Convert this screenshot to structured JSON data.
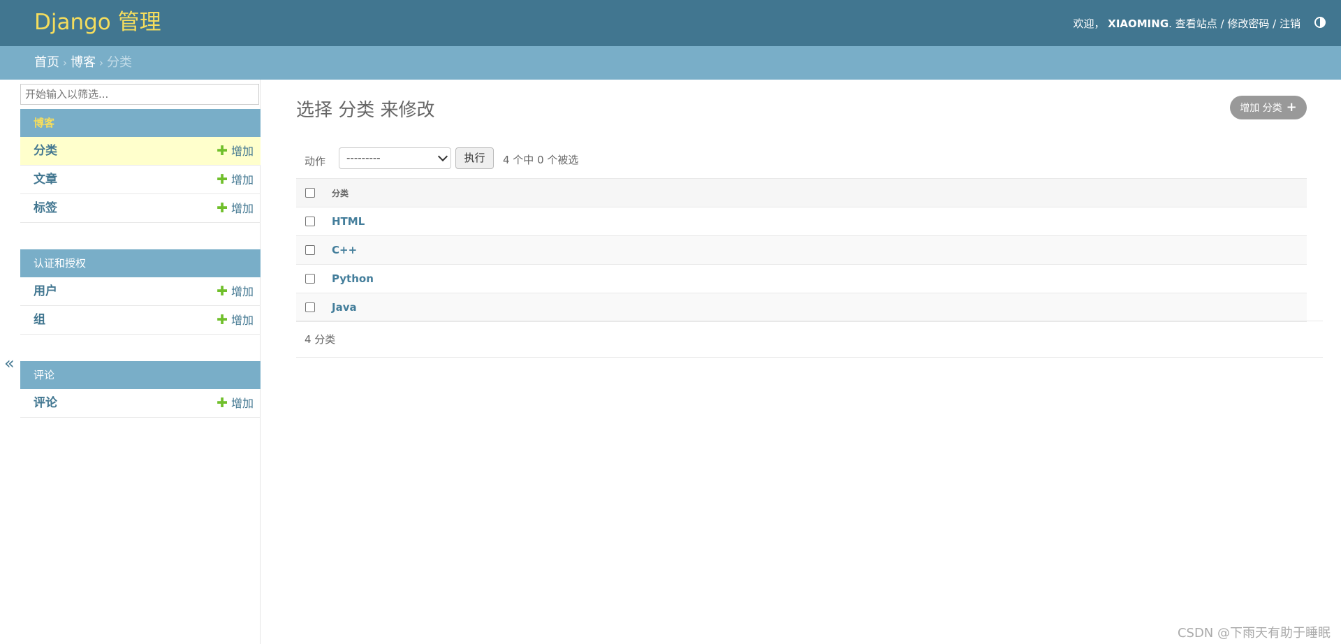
{
  "header": {
    "brand": "Django 管理",
    "welcome": "欢迎，",
    "username": "XIAOMING",
    "period": ".",
    "view_site": "查看站点",
    "slash": "/",
    "change_password": "修改密码",
    "logout": "注销"
  },
  "breadcrumbs": {
    "home": "首页",
    "app": "博客",
    "current": "分类",
    "separator": "›"
  },
  "sidebar": {
    "filter_placeholder": "开始输入以筛选...",
    "modules": [
      {
        "caption": "博客",
        "items": [
          {
            "name": "分类",
            "add": "增加"
          },
          {
            "name": "文章",
            "add": "增加"
          },
          {
            "name": "标签",
            "add": "增加"
          }
        ]
      },
      {
        "caption": "认证和授权",
        "items": [
          {
            "name": "用户",
            "add": "增加"
          },
          {
            "name": "组",
            "add": "增加"
          }
        ]
      },
      {
        "caption": "评论",
        "items": [
          {
            "name": "评论",
            "add": "增加"
          }
        ]
      }
    ],
    "collapse_glyph": "«"
  },
  "main": {
    "title": "选择 分类 来修改",
    "add_button": "增加 分类",
    "add_glyph": "+",
    "actions": {
      "label": "动作",
      "select_value": "---------",
      "go_button": "执行",
      "counter": "4 个中 0 个被选"
    },
    "table": {
      "column": "分类",
      "rows": [
        "HTML",
        "C++",
        "Python",
        "Java"
      ]
    },
    "paginator": "4 分类"
  },
  "watermark": "CSDN @下雨天有助于睡眠",
  "colors": {
    "header_bg": "#417690",
    "brand": "#f5dd5d",
    "breadcrumbs_bg": "#79aec8",
    "link": "#417690",
    "add_green": "#70bf2b",
    "current_row_bg": "#ffffcc"
  },
  "icons": {
    "theme_toggle": "half-circle-icon",
    "add": "plus-icon",
    "collapse": "double-chevron-left-icon",
    "select": "chevron-down-icon"
  }
}
